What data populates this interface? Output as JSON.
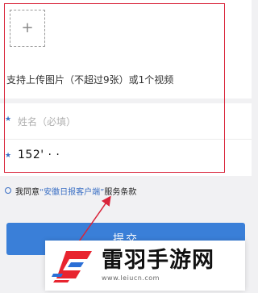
{
  "upload": {
    "plus_glyph": "+",
    "hint": "支持上传图片（不超过9张）或1个视频"
  },
  "form": {
    "required_marker": "★",
    "name_placeholder": "姓名（必填）",
    "phone_value": "152' · ·"
  },
  "agreement": {
    "prefix": "我同意",
    "link": "“安徽日报客户端”",
    "suffix": "服务条款"
  },
  "submit": {
    "label": "提交"
  },
  "watermark": {
    "title": "雷羽手游网",
    "url": "www.leiucn.com"
  },
  "colors": {
    "accent_blue": "#3a7fd8",
    "highlight_red": "#d9243a",
    "link_blue": "#3a6fc4"
  }
}
